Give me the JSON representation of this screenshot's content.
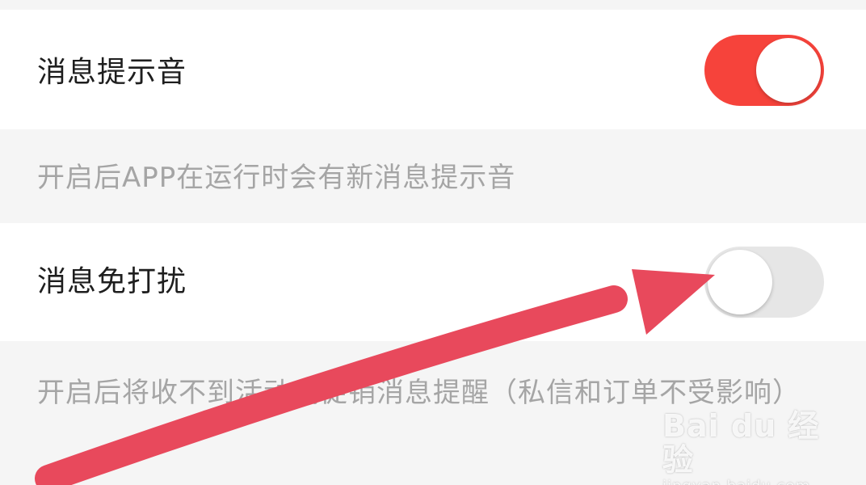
{
  "settings": {
    "items": [
      {
        "label": "消息提示音",
        "enabled": true,
        "description": "开启后APP在运行时会有新消息提示音"
      },
      {
        "label": "消息免打扰",
        "enabled": false,
        "description": "开启后将收不到活动或促销消息提醒（私信和订单不受影响）"
      }
    ]
  },
  "colors": {
    "toggle_on": "#f6433b",
    "toggle_off": "#e6e6e6",
    "annotation_arrow": "#e8495c"
  },
  "icons": {
    "annotation": "red-arrow-icon"
  },
  "watermark": {
    "logo": "Bai du 经验",
    "url": "jingyan.baidu.com"
  }
}
